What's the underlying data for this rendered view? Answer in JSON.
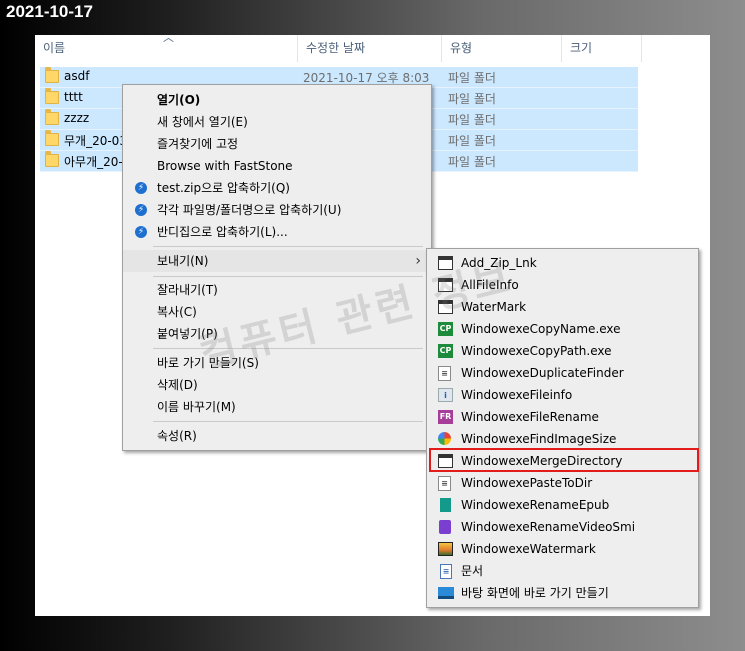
{
  "date_label": "2021-10-17",
  "columns": {
    "name": "이름",
    "date_modified": "수정한 날짜",
    "type": "유형",
    "size": "크기"
  },
  "files": [
    {
      "name": "asdf",
      "date": "2021-10-17 오후 8:03",
      "type": "파일 폴더"
    },
    {
      "name": "tttt",
      "date": "",
      "type": "파일 폴더"
    },
    {
      "name": "zzzz",
      "date": "",
      "type": "파일 폴더"
    },
    {
      "name": "무개_20-03",
      "date": "",
      "type": "파일 폴더"
    },
    {
      "name": "아무개_20-",
      "date": "",
      "type": "파일 폴더"
    }
  ],
  "context_menu": {
    "items": [
      "열기(O)",
      "새 창에서 열기(E)",
      "즐겨찾기에 고정",
      "Browse with FastStone",
      "test.zip으로 압축하기(Q)",
      "각각 파일명/폴더명으로 압축하기(U)",
      "반디집으로 압축하기(L)...",
      "보내기(N)",
      "잘라내기(T)",
      "복사(C)",
      "붙여넣기(P)",
      "바로 가기 만들기(S)",
      "삭제(D)",
      "이름 바꾸기(M)",
      "속성(R)"
    ]
  },
  "send_to_menu": {
    "items": [
      {
        "label": "Add_Zip_Lnk",
        "icon": "window-icon"
      },
      {
        "label": "AllFileInfo",
        "icon": "window-icon"
      },
      {
        "label": "WaterMark",
        "icon": "window-icon"
      },
      {
        "label": "WindowexeCopyName.exe",
        "icon": "cp-icon",
        "icon_text": "CP"
      },
      {
        "label": "WindowexeCopyPath.exe",
        "icon": "cp-icon",
        "icon_text": "CP"
      },
      {
        "label": "WindowexeDuplicateFinder",
        "icon": "document-icon"
      },
      {
        "label": "WindowexeFileinfo",
        "icon": "info-icon"
      },
      {
        "label": "WindowexeFileRename",
        "icon": "fr-icon",
        "icon_text": "FR"
      },
      {
        "label": "WindowexeFindImageSize",
        "icon": "pinwheel-icon"
      },
      {
        "label": "WindowexeMergeDirectory",
        "icon": "window-icon"
      },
      {
        "label": "WindowexePasteToDir",
        "icon": "document-icon"
      },
      {
        "label": "WindowexeRenameEpub",
        "icon": "book-icon"
      },
      {
        "label": "WindowexeRenameVideoSmi",
        "icon": "video-icon"
      },
      {
        "label": "WindowexeWatermark",
        "icon": "image-icon"
      },
      {
        "label": "문서",
        "icon": "text-document-icon"
      },
      {
        "label": "바탕 화면에 바로 가기 만들기",
        "icon": "desktop-icon"
      }
    ]
  },
  "watermark": "컴퓨터 관련 정보",
  "colors": {
    "selection": "#cce8ff",
    "highlight_border": "#e21b1b",
    "menu_bg": "#eeeeee"
  }
}
